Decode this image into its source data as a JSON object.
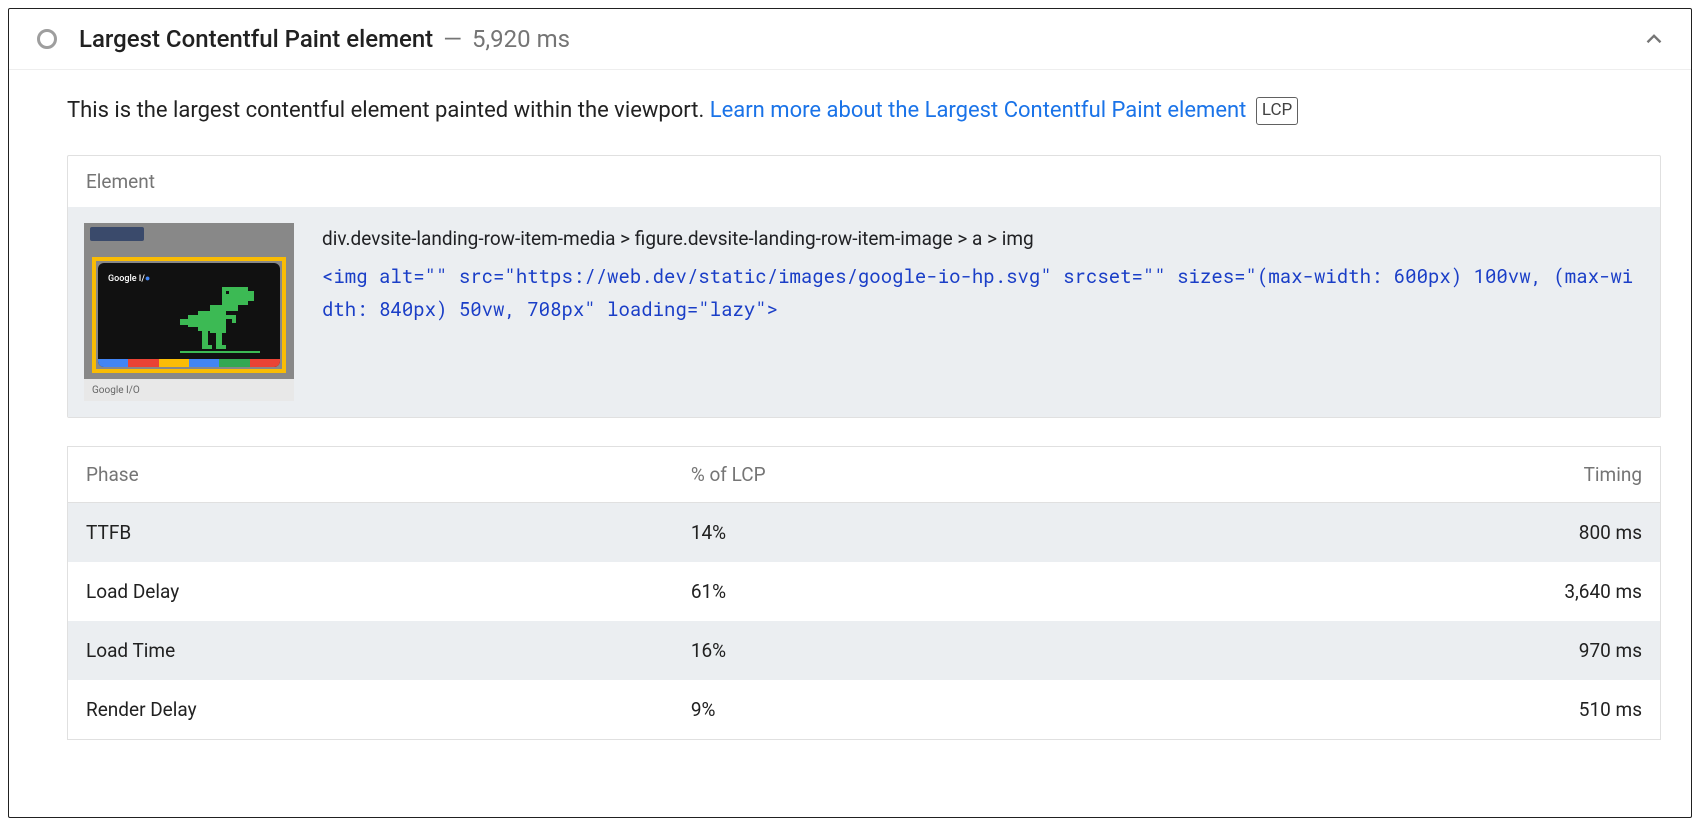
{
  "header": {
    "title": "Largest Contentful Paint element",
    "dash": "—",
    "timing": "5,920 ms"
  },
  "description": {
    "intro": "This is the largest contentful element painted within the viewport. ",
    "link_text": "Learn more about the Largest Contentful Paint element",
    "badge": "LCP"
  },
  "element_panel": {
    "header": "Element",
    "selector": "div.devsite-landing-row-item-media > figure.devsite-landing-row-item-image > a > img",
    "html": "<img alt=\"\" src=\"https://web.dev/static/images/google-io-hp.svg\" srcset=\"\" sizes=\"(max-width: 600px) 100vw, (max-width: 840px) 50vw, 708px\" loading=\"lazy\">",
    "thumb_logo": "Google I/",
    "thumb_caption": "Google I/O"
  },
  "table": {
    "columns": {
      "phase": "Phase",
      "pct": "% of LCP",
      "timing": "Timing"
    },
    "rows": [
      {
        "phase": "TTFB",
        "pct": "14%",
        "timing": "800 ms"
      },
      {
        "phase": "Load Delay",
        "pct": "61%",
        "timing": "3,640 ms"
      },
      {
        "phase": "Load Time",
        "pct": "16%",
        "timing": "970 ms"
      },
      {
        "phase": "Render Delay",
        "pct": "9%",
        "timing": "510 ms"
      }
    ]
  }
}
